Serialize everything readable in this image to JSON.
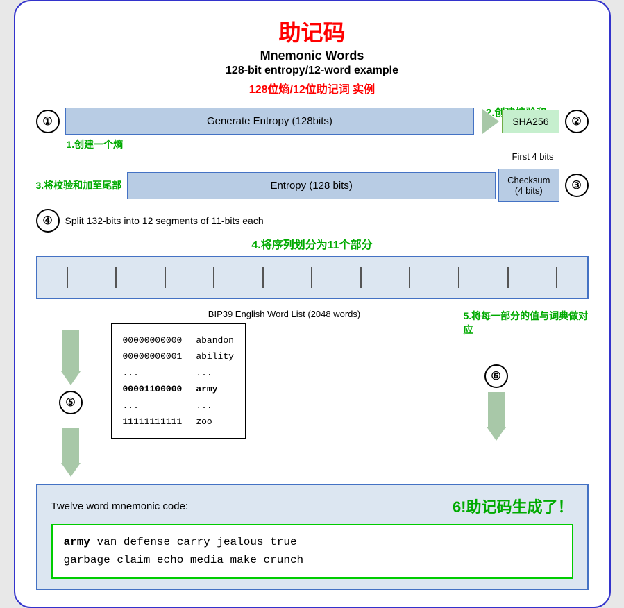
{
  "title": {
    "zh": "助记码",
    "en1": "Mnemonic Words",
    "en2": "128-bit entropy/12-word example",
    "zh2": "128位熵/12位助记词 实例"
  },
  "labels": {
    "label2": "2.创建校验和",
    "label1": "1.创建一个熵",
    "label3": "3.将校验和加至尾部",
    "label4": "4.将序列划分为11个部分",
    "label5": "5.将每一部分的值与词典做对应",
    "label6": "6!助记码生成了！"
  },
  "steps": {
    "step1": {
      "num": "①",
      "entropy_label": "Generate Entropy (128bits)",
      "sha_label": "SHA256",
      "first4bits": "First 4 bits",
      "num2": "②"
    },
    "step3": {
      "entropy_label": "Entropy (128 bits)",
      "checksum_label": "Checksum\n(4 bits)",
      "num": "③"
    },
    "step4": {
      "num": "④",
      "description": "Split 132-bits into 12 segments of 11-bits each"
    },
    "step5": {
      "num": "⑤",
      "bip39_label": "BIP39 English Word List (2048 words)",
      "bits": [
        "00000000000",
        "00000000001",
        "...",
        "00001100000",
        "...",
        "11111111111"
      ],
      "words": [
        "abandon",
        "ability",
        "...",
        "army",
        "...",
        "zoo"
      ],
      "num6": "⑥"
    },
    "final": {
      "twelve_word_label": "Twelve word mnemonic code:",
      "mnemonic_first": "army",
      "mnemonic_rest": " van defense carry jealous true\ngarbage claim echo media make crunch"
    }
  }
}
